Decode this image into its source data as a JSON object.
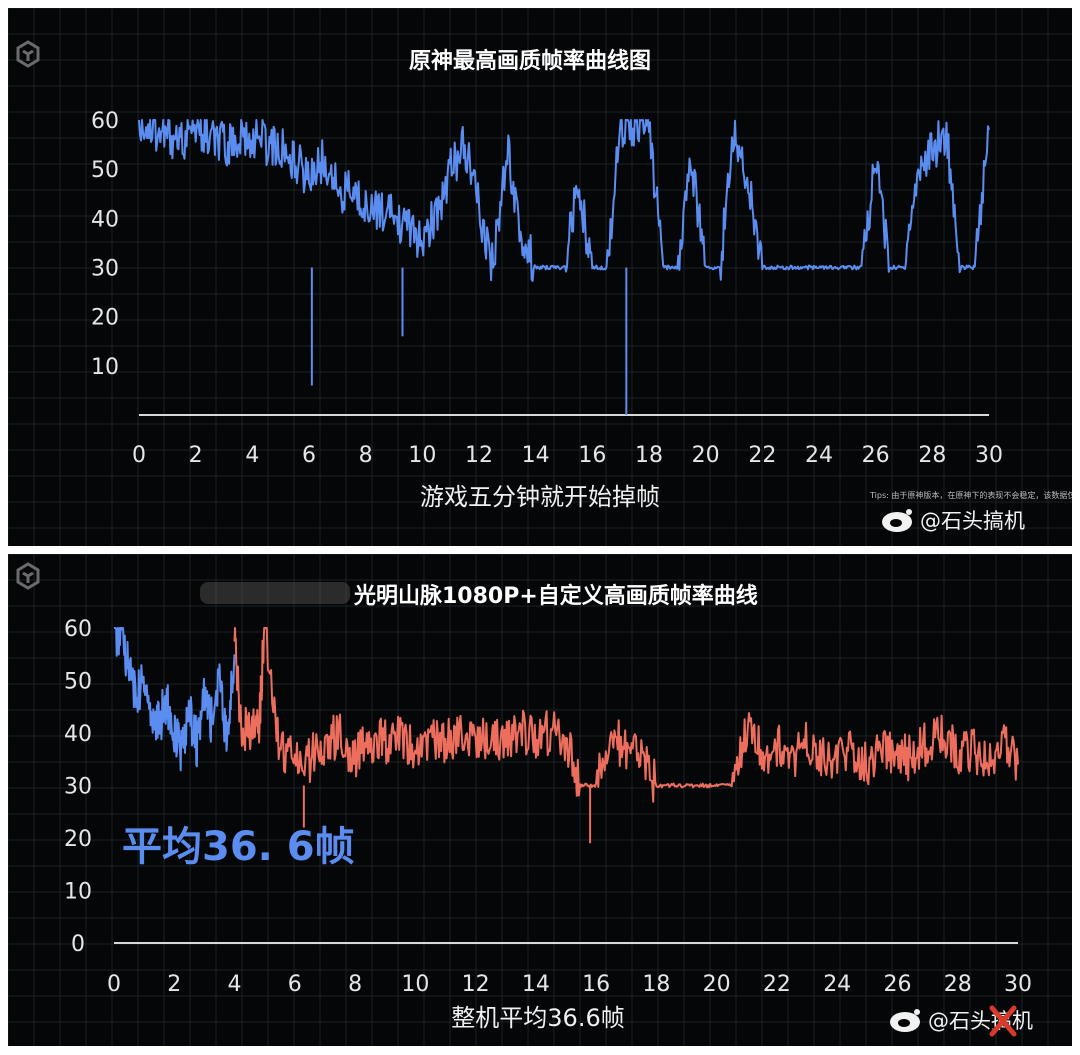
{
  "colors": {
    "background": "#050608",
    "grid": "#1b2226",
    "blue_series": "#5b8df0",
    "red_series": "#ee6e5e",
    "axis": "#d8d8d8",
    "average_text": "#5b8df0",
    "watermark_red": "#d83a2c"
  },
  "icons": {
    "logo": "logo-icon",
    "weibo": "weibo-icon"
  },
  "chart_data": [
    {
      "type": "line",
      "title": "原神最高画质帧率曲线图",
      "xlabel": "游戏五分钟就开始掉帧",
      "ylabel": "",
      "xlim": [
        0,
        30
      ],
      "ylim": [
        0,
        60
      ],
      "grid": true,
      "x_ticks": [
        "0",
        "2",
        "4",
        "6",
        "8",
        "10",
        "12",
        "14",
        "16",
        "18",
        "20",
        "22",
        "24",
        "26",
        "28",
        "30"
      ],
      "y_ticks": [
        "10",
        "20",
        "30",
        "40",
        "50",
        "60"
      ],
      "tips_text": "Tips: 由于原神版本，在原神下的表现不会稳定，该数据仅供参考，本测仅供参考不代表全部，请保持关注",
      "credit": "@石头搞机",
      "series": [
        {
          "color": "#5b8df0",
          "x": [
            0,
            0.5,
            1,
            1.5,
            2,
            2.5,
            3,
            3.5,
            4,
            4.5,
            5,
            5.5,
            6,
            6.5,
            7,
            7.5,
            8,
            8.5,
            9,
            9.5,
            10,
            10.5,
            11,
            11.5,
            12,
            12.5,
            13,
            13.5,
            14,
            14.5,
            15,
            15.5,
            16,
            16.5,
            17,
            17.5,
            18,
            18.5,
            19,
            19.5,
            20,
            20.5,
            21,
            21.5,
            22,
            22.5,
            23,
            23.5,
            24,
            24.5,
            25,
            25.5,
            26,
            26.5,
            27,
            27.5,
            28,
            28.5,
            29,
            29.5,
            30
          ],
          "values": [
            60,
            58,
            57,
            56,
            58,
            56,
            55,
            56,
            57,
            55,
            54,
            52,
            48,
            52,
            46,
            45,
            43,
            42,
            40,
            38,
            35,
            41,
            50,
            55,
            42,
            30,
            55,
            36,
            30,
            30,
            30,
            47,
            30,
            30,
            59,
            59,
            58,
            30,
            30,
            52,
            30,
            30,
            57,
            48,
            30,
            30,
            30,
            30,
            30,
            30,
            30,
            30,
            52,
            30,
            30,
            50,
            54,
            57,
            30,
            30,
            58
          ]
        }
      ],
      "annotations": [
        {
          "x": 6.1,
          "value": 6
        },
        {
          "x": 9.3,
          "value": 16
        },
        {
          "x": 17.2,
          "value": 0
        }
      ]
    },
    {
      "type": "line",
      "title": "光明山脉1080P+自定义高画质帧率曲线",
      "xlabel": "整机平均36.6帧",
      "ylabel": "",
      "xlim": [
        0,
        30
      ],
      "ylim": [
        0,
        60
      ],
      "grid": true,
      "x_ticks": [
        "0",
        "2",
        "4",
        "6",
        "8",
        "10",
        "12",
        "14",
        "16",
        "18",
        "20",
        "22",
        "24",
        "26",
        "28",
        "30"
      ],
      "y_ticks": [
        "0",
        "10",
        "20",
        "30",
        "40",
        "50",
        "60"
      ],
      "average_label": "平均36. 6帧",
      "credit": "@石头搞机",
      "series": [
        {
          "color": "#5b8df0",
          "x": [
            0,
            0.25,
            0.5,
            0.75,
            1,
            1.25,
            1.5,
            1.75,
            2,
            2.25,
            2.5,
            2.75,
            3,
            3.25,
            3.5,
            3.75,
            4
          ],
          "values": [
            58,
            60,
            52,
            47,
            50,
            43,
            42,
            46,
            40,
            36,
            44,
            38,
            47,
            42,
            51,
            38,
            55
          ]
        },
        {
          "color": "#ee6e5e",
          "x": [
            4,
            4.2,
            4.5,
            4.8,
            5,
            5.5,
            6,
            6.5,
            7,
            7.5,
            8,
            8.5,
            9,
            9.5,
            10,
            10.5,
            11,
            11.5,
            12,
            12.5,
            13,
            13.5,
            14,
            14.5,
            15,
            15.5,
            16,
            16.5,
            17,
            17.5,
            18,
            18.5,
            19,
            19.5,
            20,
            20.5,
            21,
            21.5,
            22,
            22.5,
            23,
            23.5,
            24,
            24.5,
            25,
            25.5,
            26,
            26.5,
            27,
            27.5,
            28,
            28.5,
            29,
            29.5,
            30
          ],
          "values": [
            58,
            41,
            41,
            41,
            60,
            37,
            36,
            35,
            38,
            40,
            35,
            39,
            38,
            40,
            36,
            39,
            38,
            40,
            39,
            39,
            38,
            40,
            39,
            40,
            38,
            30,
            30,
            40,
            36,
            35,
            30,
            30,
            30,
            30,
            30,
            30,
            41,
            36,
            38,
            35,
            38,
            36,
            35,
            37,
            34,
            38,
            36,
            35,
            38,
            39,
            36,
            37,
            35,
            38,
            34
          ]
        }
      ],
      "annotations": [
        {
          "x": 6.3,
          "value": 22
        },
        {
          "x": 15.8,
          "value": 19
        }
      ]
    }
  ]
}
